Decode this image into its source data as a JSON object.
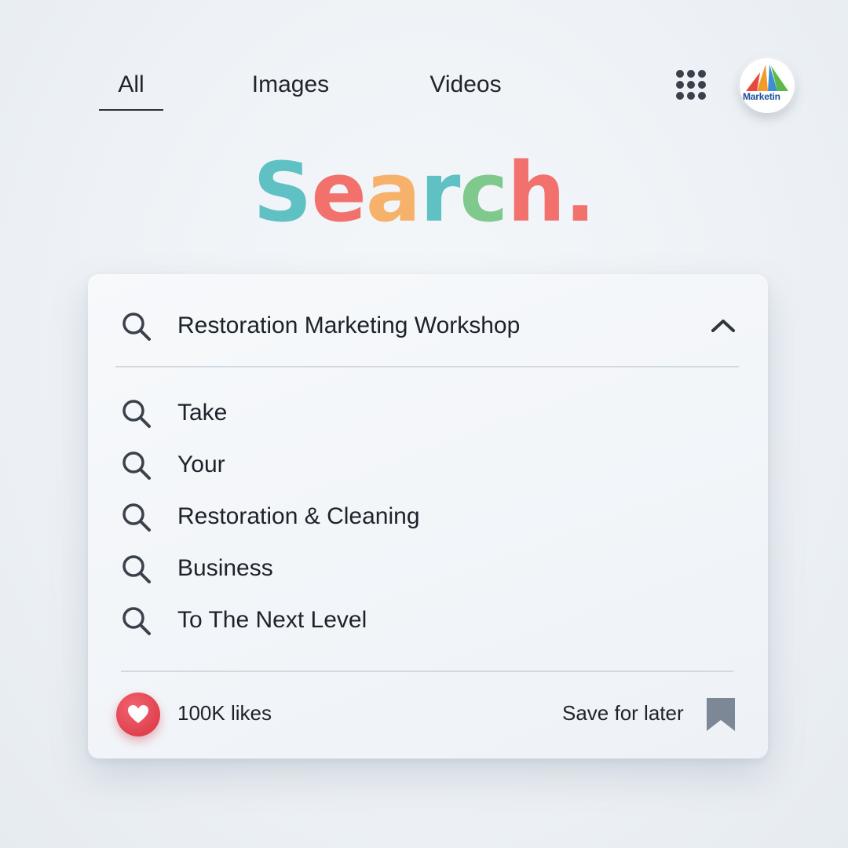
{
  "nav": {
    "tabs": [
      {
        "label": "All",
        "active": true
      },
      {
        "label": "Images",
        "active": false
      },
      {
        "label": "Videos",
        "active": false
      }
    ],
    "apps_icon": "grid-dots-icon",
    "avatar_logo_text": "Marketin"
  },
  "headline": {
    "letters": [
      {
        "char": "S",
        "color": "#5fc1c4"
      },
      {
        "char": "e",
        "color": "#f2716d"
      },
      {
        "char": "a",
        "color": "#f6b16a"
      },
      {
        "char": "r",
        "color": "#5fc1c4"
      },
      {
        "char": "c",
        "color": "#7fc98c"
      },
      {
        "char": "h",
        "color": "#f2716d"
      },
      {
        "char": ".",
        "color": "#f2716d"
      }
    ]
  },
  "search": {
    "query": "Restoration Marketing Workshop",
    "expanded": true,
    "suggestions": [
      "Take",
      "Your",
      "Restoration & Cleaning",
      "Business",
      "To The Next Level"
    ]
  },
  "footer": {
    "likes": "100K  likes",
    "save_label": "Save for later"
  },
  "colors": {
    "heart": "#e0414f",
    "bookmark": "#7d8896",
    "icon_dark": "#3a414a"
  }
}
